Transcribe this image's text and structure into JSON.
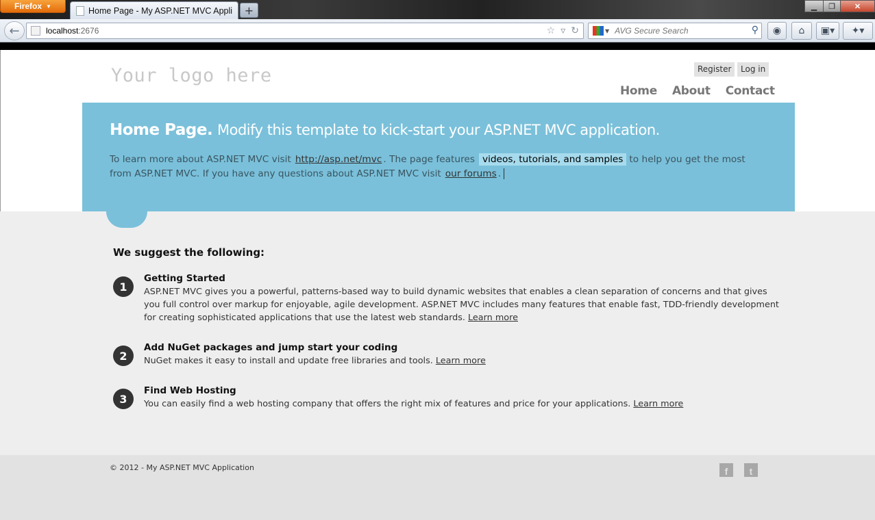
{
  "browser": {
    "menu_button": "Firefox",
    "tab_title": "Home Page - My ASP.NET MVC Applica...",
    "new_tab": "+",
    "url_host": "localhost",
    "url_port": ":2676",
    "search_placeholder": "AVG Secure Search"
  },
  "header": {
    "logo": "Your logo here",
    "register": "Register",
    "login": "Log in",
    "menu": [
      "Home",
      "About",
      "Contact"
    ]
  },
  "featured": {
    "title": "Home Page.",
    "subtitle": "Modify this template to kick-start your ASP.NET MVC application.",
    "text_1": "To learn more about ASP.NET MVC visit",
    "link_1": "http://asp.net/mvc",
    "text_2": ". The page features",
    "mark": "videos, tutorials, and samples",
    "text_3": "to help you get the most from ASP.NET MVC. If you have any questions about ASP.NET MVC visit",
    "link_2": "our forums",
    "text_4": "."
  },
  "suggest": {
    "title": "We suggest the following:",
    "steps": [
      {
        "num": "1",
        "title": "Getting Started",
        "text": "ASP.NET MVC gives you a powerful, patterns-based way to build dynamic websites that enables a clean separation of concerns and that gives you full control over markup for enjoyable, agile development. ASP.NET MVC includes many features that enable fast, TDD-friendly development for creating sophisticated applications that use the latest web standards.",
        "link": "Learn more"
      },
      {
        "num": "2",
        "title": "Add NuGet packages and jump start your coding",
        "text": "NuGet makes it easy to install and update free libraries and tools.",
        "link": "Learn more"
      },
      {
        "num": "3",
        "title": "Find Web Hosting",
        "text": "You can easily find a web hosting company that offers the right mix of features and price for your applications.",
        "link": "Learn more"
      }
    ]
  },
  "footer": {
    "copyright": "© 2012 - My ASP.NET MVC Application"
  },
  "icons": {
    "facebook": "facebook-icon",
    "twitter": "twitter-icon"
  },
  "colors": {
    "featured_bg": "#7ac0da",
    "content_bg": "#efeeef",
    "footer_bg": "#e2e2e2"
  }
}
